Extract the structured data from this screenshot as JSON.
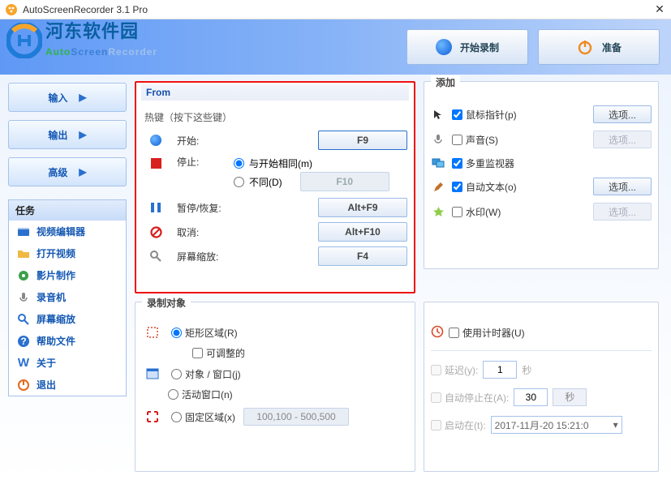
{
  "window": {
    "title": "AutoScreenRecorder 3.1 Pro"
  },
  "watermark": {
    "brand": "河东软件园",
    "logo_green": "Auto",
    "logo_blue": "Screen",
    "logo_faded": "Recorder"
  },
  "topbuttons": {
    "record": "开始录制",
    "ready": "准备"
  },
  "nav": {
    "input": "输入",
    "output": "输出",
    "advanced": "高级"
  },
  "tasks": {
    "title": "任务",
    "items": [
      "视频编辑器",
      "打开视频",
      "影片制作",
      "录音机",
      "屏幕缩放",
      "帮助文件",
      "关于",
      "退出"
    ]
  },
  "from": {
    "title": "From",
    "sub": "热键（按下这些键）",
    "start": "开始:",
    "stop": "停止:",
    "stop_same": "与开始相同(m)",
    "stop_diff": "不同(D)",
    "pause": "暂停/恢复:",
    "cancel": "取消:",
    "zoom": "屏幕缩放:",
    "keys": {
      "start": "F9",
      "stop": "F10",
      "pause": "Alt+F9",
      "cancel": "Alt+F10",
      "zoom": "F4"
    }
  },
  "add": {
    "title": "添加",
    "mouse": "鼠标指针(p)",
    "sound": "声音(S)",
    "multimon": "多重监视器",
    "autotext": "自动文本(o)",
    "watermark": "水印(W)",
    "opt": "选项..."
  },
  "rec": {
    "title": "录制对象",
    "rect": "矩形区域(R)",
    "adjustable": "可调整的",
    "objwin": "对象 / 窗口(j)",
    "active": "活动窗口(n)",
    "fixed": "固定区域(x)",
    "coords": "100,100 - 500,500"
  },
  "timer": {
    "use": "使用计时器(U)",
    "delay": "延迟(y):",
    "delay_val": "1",
    "sec": "秒",
    "autostop": "自动停止在(A):",
    "autostop_val": "30",
    "startat": "启动在(t):",
    "date": "2017-11月-20 15:21:0"
  }
}
